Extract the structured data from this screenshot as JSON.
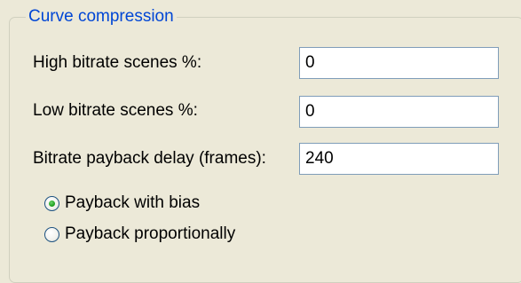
{
  "group": {
    "title": "Curve compression"
  },
  "fields": {
    "high_bitrate": {
      "label": "High bitrate scenes %:",
      "value": "0"
    },
    "low_bitrate": {
      "label": "Low bitrate scenes %:",
      "value": "0"
    },
    "payback_delay": {
      "label": "Bitrate payback delay (frames):",
      "value": "240"
    }
  },
  "payback_mode": {
    "options": [
      {
        "label": "Payback with bias",
        "selected": true
      },
      {
        "label": "Payback proportionally",
        "selected": false
      }
    ]
  },
  "colors": {
    "window_bg": "#ece9d8",
    "group_title": "#0046d5",
    "textbox_border": "#7f9db9",
    "radio_selected": "#21a121"
  }
}
